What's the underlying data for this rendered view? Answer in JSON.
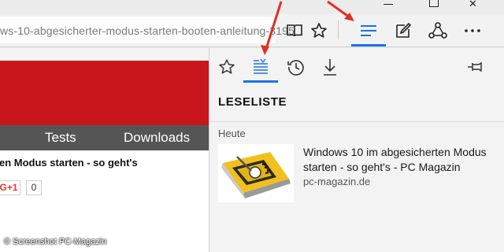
{
  "toolbar": {
    "url": "ws-10-abgesicherter-modus-starten-booten-anleitung-3195",
    "icons": [
      "reading-view-icon",
      "favorite-star-icon",
      "hub-icon",
      "web-note-icon",
      "share-icon",
      "more-icon"
    ],
    "accent": "#1a73e8"
  },
  "page": {
    "nav": {
      "tests": "Tests",
      "downloads": "Downloads"
    },
    "headline": "en Modus starten - so geht's",
    "gplus": "G+1",
    "gplus_count": "0",
    "watermark": "© Screenshot PC-Magazin",
    "brand_red": "#c9161c"
  },
  "panel": {
    "tabs": [
      "favorites-tab-icon",
      "reading-list-tab-icon",
      "history-tab-icon",
      "downloads-tab-icon"
    ],
    "title": "LESELISTE",
    "section": "Heute",
    "items": [
      {
        "title": "Windows 10 im abgesicherten Modus starten - so geht's - PC Magazin",
        "url": "pc-magazin.de"
      }
    ]
  },
  "annotation_color": "#e0301e"
}
